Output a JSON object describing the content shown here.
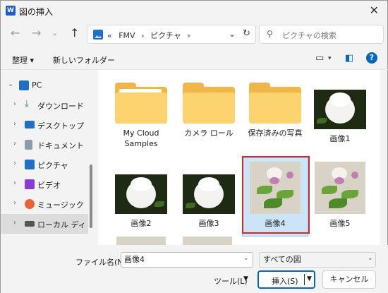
{
  "window": {
    "title": "図の挿入",
    "app_badge": "W"
  },
  "nav": {
    "back_glyph": "←",
    "forward_glyph": "→",
    "recent_glyph": "⌄",
    "up_glyph": "↑",
    "address_prefix": "«",
    "address_segments": [
      "FMV",
      "ピクチャ"
    ],
    "address_separator": "›",
    "search_placeholder": "ピクチャの検索"
  },
  "command_bar": {
    "organize": "整理 ▾",
    "new_folder": "新しいフォルダー"
  },
  "sidebar": {
    "items": [
      {
        "label": "PC",
        "icon": "monitor-icon",
        "color": "#1f6fc5"
      },
      {
        "label": "ダウンロード",
        "icon": "download-icon",
        "color": "#1a8f5f"
      },
      {
        "label": "デスクトップ",
        "icon": "desktop-icon",
        "color": "#1f6fc5"
      },
      {
        "label": "ドキュメント",
        "icon": "document-icon",
        "color": "#6b7b8c"
      },
      {
        "label": "ピクチャ",
        "icon": "pictures-icon",
        "color": "#1f6fc5"
      },
      {
        "label": "ビデオ",
        "icon": "video-icon",
        "color": "#8a3bd1"
      },
      {
        "label": "ミュージック",
        "icon": "music-icon",
        "color": "#e8623a"
      },
      {
        "label": "ローカル ディスク (",
        "icon": "drive-icon",
        "color": "#555555"
      }
    ]
  },
  "files": [
    {
      "name": "My Cloud Samples",
      "kind": "folder"
    },
    {
      "name": "カメラ ロール",
      "kind": "folder"
    },
    {
      "name": "保存済みの写真",
      "kind": "folder"
    },
    {
      "name": "画像1",
      "kind": "photo-dark"
    },
    {
      "name": "画像2",
      "kind": "photo-dark"
    },
    {
      "name": "画像3",
      "kind": "photo-dark"
    },
    {
      "name": "画像4",
      "kind": "photo-light",
      "selected": true
    },
    {
      "name": "画像5",
      "kind": "photo-light"
    }
  ],
  "footer": {
    "filename_label": "ファイル名(N):",
    "filename_value": "画像4",
    "filetype_value": "すべての図",
    "tools_label": "ツール(L)",
    "insert_label": "挿入(S)",
    "cancel_label": "キャンセル"
  },
  "colors": {
    "accent": "#0067c0",
    "highlight_border": "#d9252a",
    "selection": "#cce4f7"
  }
}
